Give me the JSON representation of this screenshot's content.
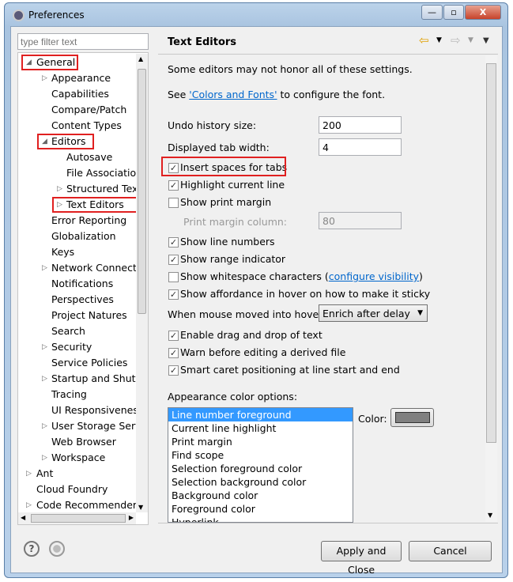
{
  "window": {
    "title": "Preferences",
    "minimize": "—",
    "maximize": "▫",
    "close": "X"
  },
  "filter": {
    "placeholder": "type filter text"
  },
  "tree": [
    {
      "label": "General",
      "level": 0,
      "arrow": "expanded",
      "highlight": true
    },
    {
      "label": "Appearance",
      "level": 1,
      "arrow": "collapsed"
    },
    {
      "label": "Capabilities",
      "level": 1
    },
    {
      "label": "Compare/Patch",
      "level": 1
    },
    {
      "label": "Content Types",
      "level": 1
    },
    {
      "label": "Editors",
      "level": 1,
      "arrow": "expanded",
      "highlight": true
    },
    {
      "label": "Autosave",
      "level": 2
    },
    {
      "label": "File Associations",
      "level": 2
    },
    {
      "label": "Structured Text",
      "level": 2,
      "arrow": "collapsed"
    },
    {
      "label": "Text Editors",
      "level": 2,
      "arrow": "collapsed",
      "highlight": true
    },
    {
      "label": "Error Reporting",
      "level": 1
    },
    {
      "label": "Globalization",
      "level": 1
    },
    {
      "label": "Keys",
      "level": 1
    },
    {
      "label": "Network Connections",
      "level": 1,
      "arrow": "collapsed"
    },
    {
      "label": "Notifications",
      "level": 1
    },
    {
      "label": "Perspectives",
      "level": 1
    },
    {
      "label": "Project Natures",
      "level": 1
    },
    {
      "label": "Search",
      "level": 1
    },
    {
      "label": "Security",
      "level": 1,
      "arrow": "collapsed"
    },
    {
      "label": "Service Policies",
      "level": 1
    },
    {
      "label": "Startup and Shutdown",
      "level": 1,
      "arrow": "collapsed"
    },
    {
      "label": "Tracing",
      "level": 1
    },
    {
      "label": "UI Responsiveness",
      "level": 1
    },
    {
      "label": "User Storage Service",
      "level": 1,
      "arrow": "collapsed"
    },
    {
      "label": "Web Browser",
      "level": 1
    },
    {
      "label": "Workspace",
      "level": 1,
      "arrow": "collapsed"
    },
    {
      "label": "Ant",
      "level": 0,
      "arrow": "collapsed"
    },
    {
      "label": "Cloud Foundry",
      "level": 0
    },
    {
      "label": "Code Recommenders",
      "level": 0,
      "arrow": "collapsed"
    }
  ],
  "page": {
    "title": "Text Editors",
    "note": "Some editors may not honor all of these settings.",
    "see_prefix": "See ",
    "see_link": "'Colors and Fonts'",
    "see_suffix": " to configure the font.",
    "undo_label": "Undo history size:",
    "undo_value": "200",
    "tab_label": "Displayed tab width:",
    "tab_value": "4",
    "checks": [
      {
        "label": "Insert spaces for tabs",
        "checked": true,
        "highlight": true
      },
      {
        "label": "Highlight current line",
        "checked": true
      },
      {
        "label": "Show print margin",
        "checked": false
      }
    ],
    "margin_label": "Print margin column:",
    "margin_value": "80",
    "checks2": [
      {
        "label": "Show line numbers",
        "checked": true
      },
      {
        "label": "Show range indicator",
        "checked": true
      },
      {
        "label": "Show whitespace characters (",
        "link": "configure visibility",
        "suffix": ")",
        "checked": false
      },
      {
        "label": "Show affordance in hover on how to make it sticky",
        "checked": true
      }
    ],
    "hover_label": "When mouse moved into hover:",
    "hover_value": "Enrich after delay",
    "checks3": [
      {
        "label": "Enable drag and drop of text",
        "checked": true
      },
      {
        "label": "Warn before editing a derived file",
        "checked": true
      },
      {
        "label": "Smart caret positioning at line start and end",
        "checked": true
      }
    ],
    "color_options_label": "Appearance color options:",
    "color_options": [
      "Line number foreground",
      "Current line highlight",
      "Print margin",
      "Find scope",
      "Selection foreground color",
      "Selection background color",
      "Background color",
      "Foreground color",
      "Hyperlink"
    ],
    "selected_option": "Line number foreground",
    "color_label": "Color:",
    "color_value": "#808080"
  },
  "buttons": {
    "apply_close": "Apply and Close",
    "cancel": "Cancel"
  },
  "colors": {
    "selection": "#3399ff",
    "highlight_box": "#e02020",
    "link": "#0066cc"
  }
}
